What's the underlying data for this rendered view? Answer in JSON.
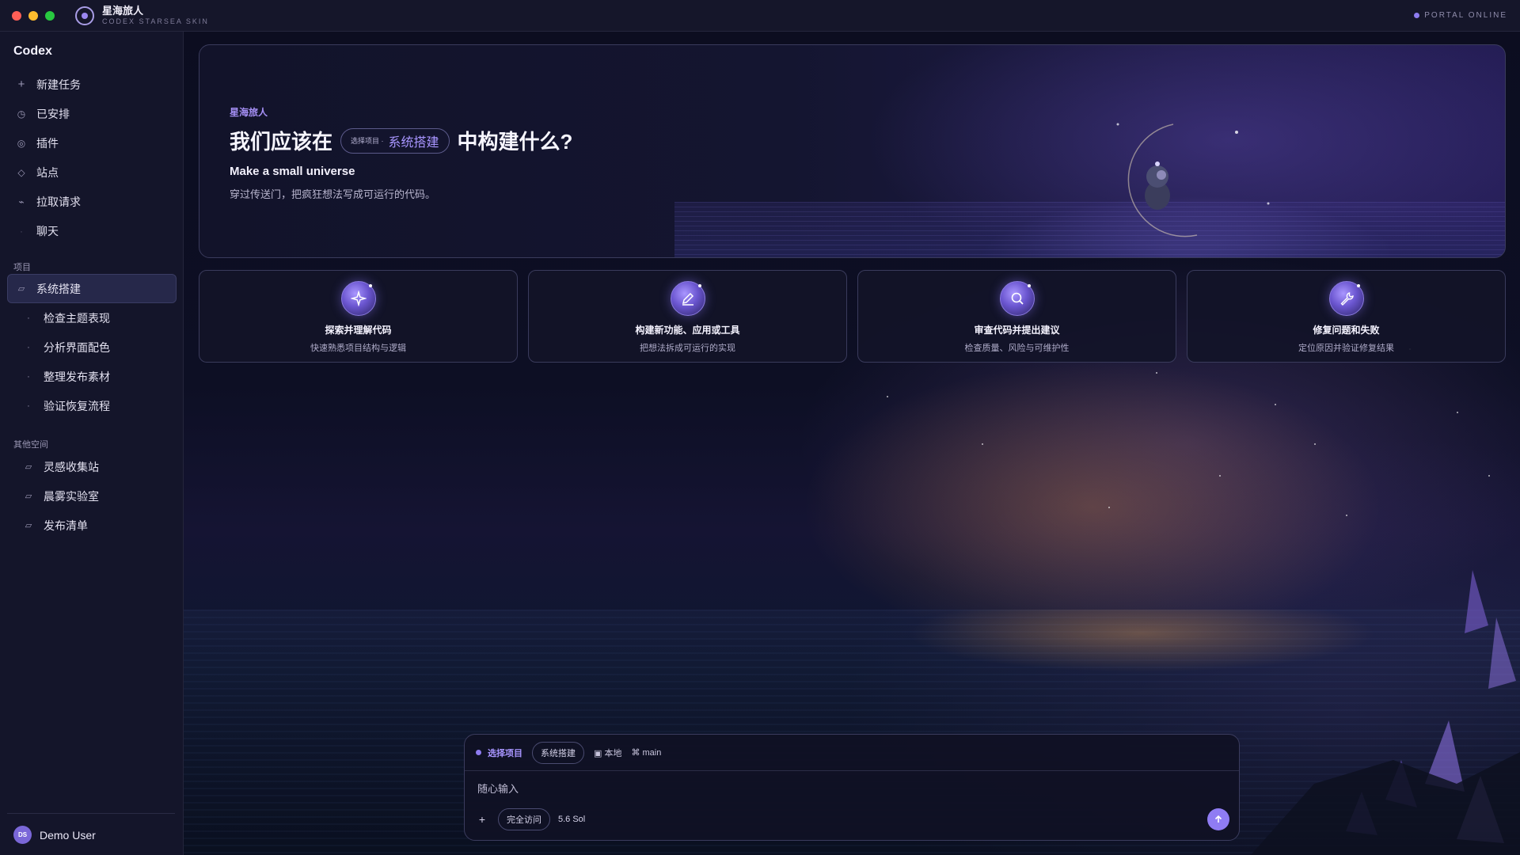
{
  "window": {
    "app_title": "星海旅人",
    "app_subtitle": "CODEX STARSEA SKIN",
    "status": "PORTAL ONLINE"
  },
  "sidebar": {
    "brand": "Codex",
    "nav": [
      {
        "label": "新建任务",
        "icon": "plus-icon"
      },
      {
        "label": "已安排",
        "icon": "clock-icon"
      },
      {
        "label": "插件",
        "icon": "plugin-icon"
      },
      {
        "label": "站点",
        "icon": "diamond-icon"
      },
      {
        "label": "拉取请求",
        "icon": "pull-request-icon"
      },
      {
        "label": "聊天",
        "icon": "chat-icon"
      }
    ],
    "projects_label": "项目",
    "projects": [
      {
        "label": "系统搭建",
        "icon": "folder-icon",
        "active": true
      },
      {
        "label": "检查主题表现",
        "icon": "dot-icon"
      },
      {
        "label": "分析界面配色",
        "icon": "dot-icon"
      },
      {
        "label": "整理发布素材",
        "icon": "dot-icon"
      },
      {
        "label": "验证恢复流程",
        "icon": "dot-icon"
      }
    ],
    "other_label": "其他空间",
    "other": [
      {
        "label": "灵感收集站",
        "icon": "folder-icon"
      },
      {
        "label": "晨雾实验室",
        "icon": "folder-icon"
      },
      {
        "label": "发布清单",
        "icon": "folder-icon"
      }
    ],
    "user": {
      "initials": "DS",
      "name": "Demo User"
    }
  },
  "hero": {
    "kicker": "星海旅人",
    "title_before": "我们应该在",
    "pill_label": "选择项目 ·",
    "pill_value": "系统搭建",
    "title_after": "中构建什么?",
    "heading": "Make a small universe",
    "description": "穿过传送门，把疯狂想法写成可运行的代码。"
  },
  "cards": [
    {
      "title": "探索并理解代码",
      "desc": "快速熟悉项目结构与逻辑",
      "icon": "sparkle-icon"
    },
    {
      "title": "构建新功能、应用或工具",
      "desc": "把想法拆成可运行的实现",
      "icon": "pencil-icon"
    },
    {
      "title": "审查代码并提出建议",
      "desc": "检查质量、风险与可维护性",
      "icon": "magnifier-icon"
    },
    {
      "title": "修复问题和失败",
      "desc": "定位原因并验证修复结果",
      "icon": "wrench-icon"
    }
  ],
  "composer": {
    "project_label": "选择项目",
    "project_value": "系统搭建",
    "location": "▣ 本地",
    "branch": "⌘ main",
    "placeholder": "随心输入",
    "access": "完全访问",
    "model": "5.6 Sol"
  },
  "colors": {
    "accent": "#8e7cf0",
    "accent_text": "#a895ff",
    "background": "#0a0b1a",
    "panel": "#14152a"
  }
}
